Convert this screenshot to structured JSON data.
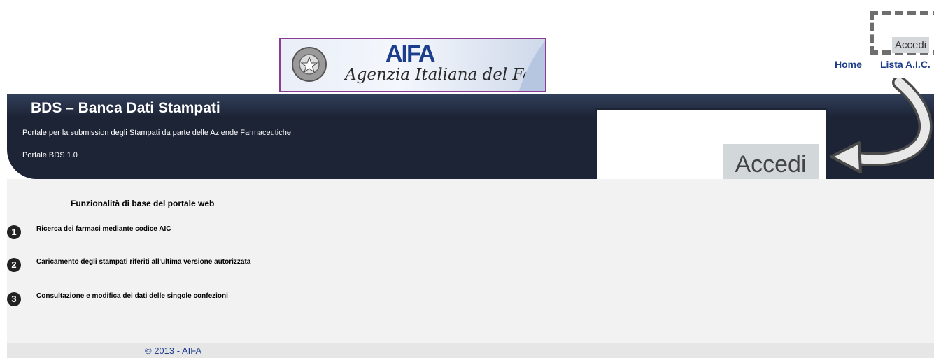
{
  "logo": {
    "mark": "AIFA",
    "agency_name": "Agenzia Italiana del Farmaco"
  },
  "nav": {
    "accedi_label": "Accedi",
    "home_label": "Home",
    "lista_aic_label": "Lista A.I.C."
  },
  "banner": {
    "title": "BDS – Banca Dati Stampati",
    "subtitle": "Portale per la submission degli Stampati da parte delle Aziende Farmaceutiche",
    "version": "Portale BDS 1.0"
  },
  "zoom": {
    "accedi_label": "Accedi"
  },
  "main": {
    "heading": "Funzionalità di base del portale web",
    "features": [
      {
        "num": "1",
        "text": "Ricerca dei farmaci mediante codice AIC"
      },
      {
        "num": "2",
        "text": "Caricamento degli stampati riferiti all'ultima versione autorizzata"
      },
      {
        "num": "3",
        "text": "Consultazione e modifica dei dati delle singole confezioni"
      }
    ]
  },
  "footer": {
    "copyright": "© 2013 - AIFA"
  },
  "colors": {
    "banner": "#1d2436",
    "link": "#1d3e8c",
    "logo_border": "#8a3c93"
  }
}
